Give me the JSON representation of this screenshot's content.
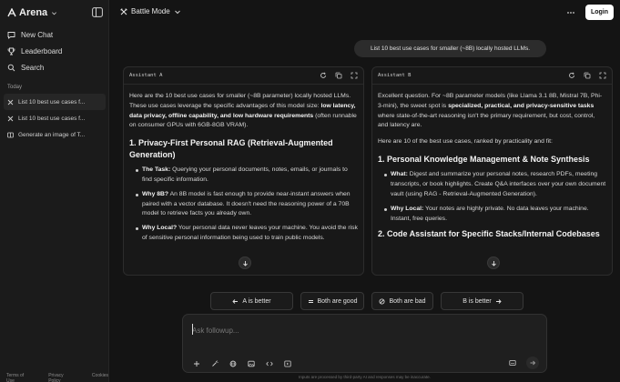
{
  "brand": {
    "name": "Arena"
  },
  "sidebar": {
    "nav": [
      {
        "label": "New Chat",
        "icon": "chat-plus-icon"
      },
      {
        "label": "Leaderboard",
        "icon": "trophy-icon"
      },
      {
        "label": "Search",
        "icon": "search-icon"
      }
    ],
    "section_label": "Today",
    "history": [
      {
        "label": "List 10 best use cases f...",
        "icon": "battle-icon",
        "active": true
      },
      {
        "label": "List 10 best use cases f...",
        "icon": "battle-icon",
        "active": false
      },
      {
        "label": "Generate an image of T...",
        "icon": "side-by-side-icon",
        "active": false
      }
    ],
    "footer": {
      "terms": "Terms of Use",
      "privacy": "Privacy Policy",
      "cookies": "Cookies"
    }
  },
  "topbar": {
    "mode": "Battle Mode",
    "login": "Login"
  },
  "prompt": "List 10 best use cases for smaller (~8B) locally hosted LLMs.",
  "panel_a": {
    "title": "Assistant A",
    "intro_pre": "Here are the 10 best use cases for smaller (~8B parameter) locally hosted LLMs. These use cases leverage the specific advantages of this model size: ",
    "intro_bold": "low latency, data privacy, offline capability, and low hardware requirements",
    "intro_post": " (often runnable on consumer GPUs with 6GB-8GB VRAM).",
    "heading": "1. Privacy-First Personal RAG (Retrieval-Augmented Generation)",
    "bullets": [
      {
        "label": "The Task:",
        "text": " Querying your personal documents, notes, emails, or journals to find specific information."
      },
      {
        "label": "Why 8B?",
        "text": " An 8B model is fast enough to provide near-instant answers when paired with a vector database. It doesn't need the reasoning power of a 70B model to retrieve facts you already own."
      },
      {
        "label": "Why Local?",
        "text": " Your personal data never leaves your machine. You avoid the risk of sensitive personal information being used to train public models."
      }
    ]
  },
  "panel_b": {
    "title": "Assistant B",
    "intro_pre": "Excellent question. For ~8B parameter models (like Llama 3.1 8B, Mistral 7B, Phi-3-mini), the sweet spot is ",
    "intro_bold": "specialized, practical, and privacy-sensitive tasks",
    "intro_post": " where state-of-the-art reasoning isn't the primary requirement, but cost, control, and latency are.",
    "intro2": "Here are 10 of the best use cases, ranked by practicality and fit:",
    "heading": "1. Personal Knowledge Management & Note Synthesis",
    "bullets": [
      {
        "label": "What:",
        "text": " Digest and summarize your personal notes, research PDFs, meeting transcripts, or book highlights. Create Q&A interfaces over your own document vault (using RAG - Retrieval-Augmented Generation)."
      },
      {
        "label": "Why Local:",
        "text": " Your notes are highly private. No data leaves your machine. Instant, free queries."
      }
    ],
    "heading2": "2. Code Assistant for Specific Stacks/Internal Codebases"
  },
  "votes": {
    "a": "A is better",
    "tie": "Both are good",
    "bad": "Both are bad",
    "b": "B is better"
  },
  "composer": {
    "placeholder": "Ask followup..."
  },
  "disclaimer": "Inputs are processed by third-party AI and responses may be inaccurate."
}
